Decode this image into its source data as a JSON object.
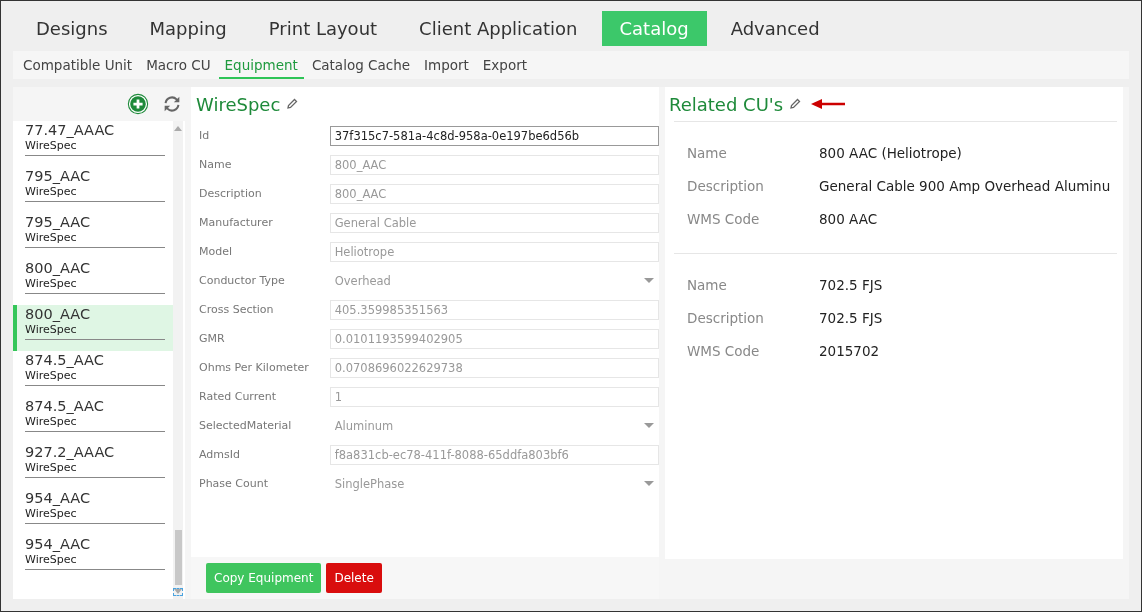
{
  "tabs": [
    {
      "label": "Designs",
      "selected": false
    },
    {
      "label": "Mapping",
      "selected": false
    },
    {
      "label": "Print Layout",
      "selected": false
    },
    {
      "label": "Client Application",
      "selected": false
    },
    {
      "label": "Catalog",
      "selected": true
    },
    {
      "label": "Advanced",
      "selected": false
    }
  ],
  "subtabs": [
    {
      "label": "Compatible Unit",
      "selected": false
    },
    {
      "label": "Macro CU",
      "selected": false
    },
    {
      "label": "Equipment",
      "selected": true
    },
    {
      "label": "Catalog Cache",
      "selected": false
    },
    {
      "label": "Import",
      "selected": false
    },
    {
      "label": "Export",
      "selected": false
    }
  ],
  "list": [
    {
      "title": "77.47_AAAC",
      "subtitle": "WireSpec",
      "selected": false
    },
    {
      "title": "795_AAC",
      "subtitle": "WireSpec",
      "selected": false
    },
    {
      "title": "795_AAC",
      "subtitle": "WireSpec",
      "selected": false
    },
    {
      "title": "800_AAC",
      "subtitle": "WireSpec",
      "selected": false
    },
    {
      "title": "800_AAC",
      "subtitle": "WireSpec",
      "selected": true
    },
    {
      "title": "874.5_AAC",
      "subtitle": "WireSpec",
      "selected": false
    },
    {
      "title": "874.5_AAC",
      "subtitle": "WireSpec",
      "selected": false
    },
    {
      "title": "927.2_AAAC",
      "subtitle": "WireSpec",
      "selected": false
    },
    {
      "title": "954_AAC",
      "subtitle": "WireSpec",
      "selected": false
    },
    {
      "title": "954_AAC",
      "subtitle": "WireSpec",
      "selected": false
    }
  ],
  "form": {
    "title": "WireSpec",
    "fields": [
      {
        "label": "Id",
        "value": "37f315c7-581a-4c8d-958a-0e197be6d56b",
        "kind": "text",
        "disabled": false
      },
      {
        "label": "Name",
        "value": "800_AAC",
        "kind": "text",
        "disabled": true
      },
      {
        "label": "Description",
        "value": "800_AAC",
        "kind": "text",
        "disabled": true
      },
      {
        "label": "Manufacturer",
        "value": "General Cable",
        "kind": "text",
        "disabled": true
      },
      {
        "label": "Model",
        "value": "Heliotrope",
        "kind": "text",
        "disabled": true
      },
      {
        "label": "Conductor Type",
        "value": "Overhead",
        "kind": "select",
        "disabled": true
      },
      {
        "label": "Cross Section",
        "value": "405.359985351563",
        "kind": "text",
        "disabled": true
      },
      {
        "label": "GMR",
        "value": "0.0101193599402905",
        "kind": "text",
        "disabled": true
      },
      {
        "label": "Ohms Per Kilometer",
        "value": "0.0708696022629738",
        "kind": "text",
        "disabled": true
      },
      {
        "label": "Rated Current",
        "value": "1",
        "kind": "text",
        "disabled": true
      },
      {
        "label": "SelectedMaterial",
        "value": "Aluminum",
        "kind": "select",
        "disabled": true
      },
      {
        "label": "AdmsId",
        "value": "f8a831cb-ec78-411f-8088-65ddfa803bf6",
        "kind": "text",
        "disabled": true
      },
      {
        "label": "Phase Count",
        "value": "SinglePhase",
        "kind": "select",
        "disabled": true
      }
    ],
    "buttons": [
      {
        "label": "Copy Equipment",
        "kind": "primary"
      },
      {
        "label": "Delete",
        "kind": "danger"
      }
    ]
  },
  "related": {
    "title": "Related CU's",
    "items": [
      {
        "rows": [
          {
            "label": "Name",
            "value": "800 AAC (Heliotrope)"
          },
          {
            "label": "Description",
            "value": "General Cable 900 Amp Overhead Aluminu"
          },
          {
            "label": "WMS Code",
            "value": "800 AAC"
          }
        ]
      },
      {
        "rows": [
          {
            "label": "Name",
            "value": "702.5 FJS"
          },
          {
            "label": "Description",
            "value": "702.5 FJS"
          },
          {
            "label": "WMS Code",
            "value": "2015702"
          }
        ]
      }
    ]
  }
}
